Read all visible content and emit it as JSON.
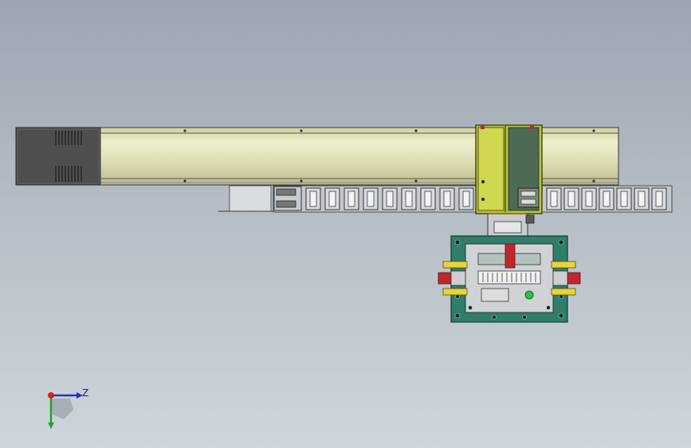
{
  "viewport": {
    "background_top": "#9ca5b0",
    "background_bottom": "#cfd5dc"
  },
  "model": {
    "rail_color": "#e3e3bd",
    "motor_color": "#4e4e4e",
    "carriage_color": "#b8c53a",
    "gripper_plate_color": "#2f7d6b",
    "cable_chain_color": "#6c6c6c",
    "accent_red": "#c0272d",
    "accent_yellow": "#e8d43a"
  },
  "triad": {
    "z_label": "Z",
    "x_color": "#d42020",
    "y_color": "#1fa52a",
    "z_color": "#2233cc"
  }
}
